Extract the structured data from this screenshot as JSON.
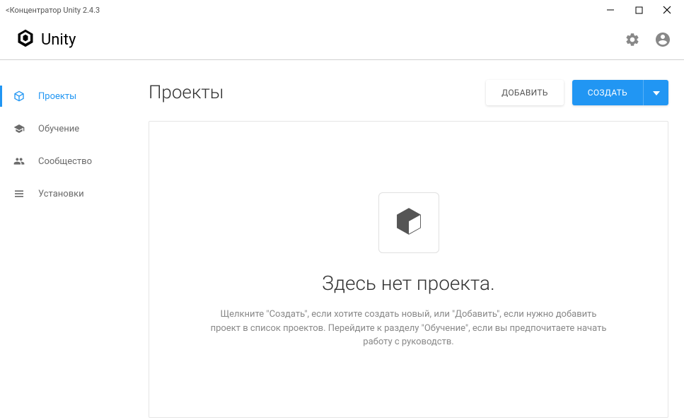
{
  "window": {
    "title": "<Концентратор Unity 2.4.3"
  },
  "header": {
    "brand": "Unity"
  },
  "sidebar": {
    "items": [
      {
        "label": "Проекты",
        "icon": "cube-icon",
        "active": true
      },
      {
        "label": "Обучение",
        "icon": "graduation-icon",
        "active": false
      },
      {
        "label": "Сообщество",
        "icon": "people-icon",
        "active": false
      },
      {
        "label": "Установки",
        "icon": "menu-icon",
        "active": false
      }
    ]
  },
  "main": {
    "title": "Проекты",
    "actions": {
      "add_label": "ДОБАВИТЬ",
      "create_label": "СОЗДАТЬ"
    },
    "empty": {
      "title": "Здесь нет проекта.",
      "text": "Щелкните \"Создать\", если хотите создать новый, или \"Добавить\", если нужно добавить проект в список проектов. Перейдите к разделу \"Обучение\", если вы предпочитаете начать работу с руководств."
    }
  },
  "colors": {
    "accent": "#2196f3"
  }
}
